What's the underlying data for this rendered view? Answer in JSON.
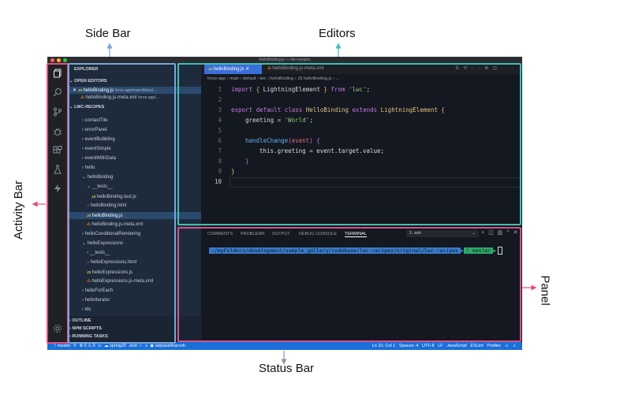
{
  "callouts": {
    "side_bar": "Side Bar",
    "editors": "Editors",
    "activity_bar": "Activity Bar",
    "panel": "Panel",
    "status_bar": "Status Bar"
  },
  "colors": {
    "side_bar": "#7aa4d8",
    "editors": "#3fbfb0",
    "activity_bar": "#e0507a",
    "panel": "#d8508a",
    "status_bar": "#8a9aa8"
  },
  "window": {
    "title": "helloBinding.js — lwc-recipes"
  },
  "activity_icons": [
    "files-icon",
    "search-icon",
    "source-control-icon",
    "debug-icon",
    "extensions-icon",
    "test-icon",
    "lightning-icon",
    "settings-gear-icon"
  ],
  "sidebar": {
    "explorer": "EXPLORER",
    "open_editors": "OPEN EDITORS",
    "open1_name": "helloBinding.js",
    "open1_path": "force-app/main/defaul...",
    "open2_name": "helloBinding.js-meta.xml",
    "open2_path": "force-app/...",
    "project": "LWC-RECIPES",
    "tree": {
      "contactTile": "contactTile",
      "errorPanel": "errorPanel",
      "eventBubbling": "eventBubbling",
      "eventSimple": "eventSimple",
      "eventWithData": "eventWithData",
      "hello": "hello",
      "helloBinding": "helloBinding",
      "tests": "__tests__",
      "helloBinding_test": "helloBinding.test.js",
      "helloBinding_html": "helloBinding.html",
      "helloBinding_js": "helloBinding.js",
      "helloBinding_meta": "helloBinding.js-meta.xml",
      "helloConditionalRendering": "helloConditionalRendering",
      "helloExpressions": "helloExpressions",
      "tests2": "__tests__",
      "helloExpressions_html": "helloExpressions.html",
      "helloExpressions_js": "helloExpressions.js",
      "helloExpressions_meta": "helloExpressions.js-meta.xml",
      "helloForEach": "helloForEach",
      "helloIterator": "helloIterator",
      "lds": "lds"
    },
    "outline": "OUTLINE",
    "npm_scripts": "NPM SCRIPTS",
    "running_tasks": "RUNNING TASKS"
  },
  "editor": {
    "tab1": "helloBinding.js",
    "tab2": "helloBinding.js-meta.xml",
    "breadcrumb": "force-app › main › default › lwc › helloBinding › JS helloBinding.js › ...",
    "line_numbers": [
      "1",
      "2",
      "3",
      "4",
      "5",
      "6",
      "7",
      "8",
      "9",
      "10"
    ],
    "code": {
      "l1_import": "import",
      "l1_brace_open": "{ ",
      "l1_name": "LightningElement",
      "l1_brace_close": " }",
      "l1_from": " from ",
      "l1_src": "'lwc'",
      "l1_end": ";",
      "l3_export": "export default class",
      "l3_cls": "HelloBinding",
      "l3_extends": "extends",
      "l3_base": "LightningElement",
      "l3_brace": "{",
      "l4_prop": "greeting = ",
      "l4_val": "'World'",
      "l4_end": ";",
      "l6_fn": "handleChange",
      "l6_paren_open": "(",
      "l6_param": "event",
      "l6_paren_close": ")",
      "l6_brace": "{",
      "l7_stmt": "this.greeting = event.target.value;",
      "l8_brace": "}",
      "l9_brace": "}"
    }
  },
  "panel": {
    "tabs": [
      "COMMENTS",
      "PROBLEMS",
      "OUTPUT",
      "DEBUG CONSOLE",
      "TERMINAL"
    ],
    "terminal_select": "1: zsh",
    "path": "~/myFolders/development/sample_gallery/codebase/lwc-recipes/original/lwc-recipes",
    "branch": "master"
  },
  "statusbar": {
    "branch": "master",
    "errors": "⊗ 0 ⚠ 0",
    "org": "spring20",
    "jest": "Jest: ✓",
    "user": "satyasekharcvb",
    "position": "Ln 10, Col 1",
    "spaces": "Spaces: 4",
    "encoding": "UTF-8",
    "eol": "LF",
    "language": "JavaScript",
    "eslint": "ESLint",
    "prettier": "Prettier"
  }
}
